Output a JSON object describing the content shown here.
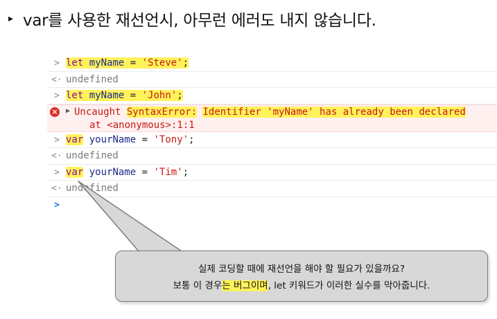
{
  "heading": {
    "bullet": "▸",
    "text": "var를 사용한 재선언시, 아무런 에러도 내지 않습니다."
  },
  "console": {
    "rows": [
      {
        "kind": "input",
        "tokens": [
          "let",
          "myName",
          "=",
          "'Steve'",
          ";"
        ]
      },
      {
        "kind": "output",
        "text": "undefined"
      },
      {
        "kind": "input",
        "tokens": [
          "let",
          "myName",
          "=",
          "'John'",
          ";"
        ]
      },
      {
        "kind": "error",
        "prefix": "Uncaught",
        "error_type": "SyntaxError:",
        "message": "Identifier 'myName' has already been declared",
        "location": "at <anonymous>:1:1"
      },
      {
        "kind": "input",
        "tokens": [
          "var",
          "yourName",
          "=",
          "'Tony'",
          ";"
        ]
      },
      {
        "kind": "output",
        "text": "undefined"
      },
      {
        "kind": "input",
        "tokens": [
          "var",
          "yourName",
          "=",
          "'Tim'",
          ";"
        ]
      },
      {
        "kind": "output",
        "text": "undefined"
      }
    ],
    "input_caret": ">",
    "output_caret": "<·",
    "error_icon": "×",
    "expand_icon": "▶"
  },
  "callout": {
    "line1": "실제 코딩할 때에 재선언을 해야 할 필요가 있을까요?",
    "line2_pre": "보통 이 경우",
    "line2_hl1": "는 버그이며",
    "line2_post": ", let 키워드가 이러한 실수를 막아줍니다."
  },
  "colors": {
    "highlight": "#fff25a",
    "keyword": "#8b0d8c",
    "identifier": "#1b2a8a",
    "string": "#c41a16",
    "error_bg": "#fff0f0",
    "callout_bg": "#d8d8d8"
  }
}
